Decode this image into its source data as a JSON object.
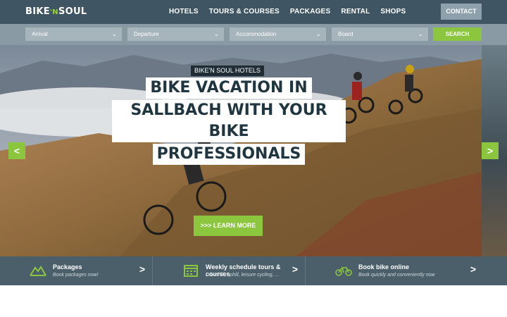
{
  "header": {
    "logo_left": "BIKE",
    "logo_mid": "'N",
    "logo_right": "SOUL",
    "nav": [
      "HOTELS",
      "TOURS & COURSES",
      "PACKAGES",
      "RENTAL",
      "SHOPS"
    ],
    "contact_label": "CONTACT"
  },
  "booking": {
    "arrival": "Arrival",
    "departure": "Departure",
    "accommodation": "Accommodation",
    "board": "Board",
    "search_label": "SEARCH"
  },
  "hero": {
    "tag": "BIKE'N SOUL HOTELS",
    "title_lines": [
      "BIKE VACATION IN",
      "SALLBACH WITH YOUR BIKE",
      "PROFESSIONALS"
    ],
    "prev_label": "<",
    "next_label": ">",
    "cta_label": ">>> LEARN MORE"
  },
  "features": [
    {
      "icon": "mountain-icon",
      "title": "Packages",
      "subtitle": "Book packages now!",
      "arrow": ">"
    },
    {
      "icon": "calendar-icon",
      "title": "Weekly schedule tours & courses",
      "subtitle": "Downhill, uphill, leisure cycling, ...",
      "arrow": ">"
    },
    {
      "icon": "bicycle-icon",
      "title": "Book bike online",
      "subtitle": "Book quickly and conveniently now",
      "arrow": ">"
    }
  ],
  "colors": {
    "header": "#3f5563",
    "booking_bar": "#8a9aa4",
    "accent_green": "#8cc63f",
    "feature_strip": "#4b5f6b"
  }
}
